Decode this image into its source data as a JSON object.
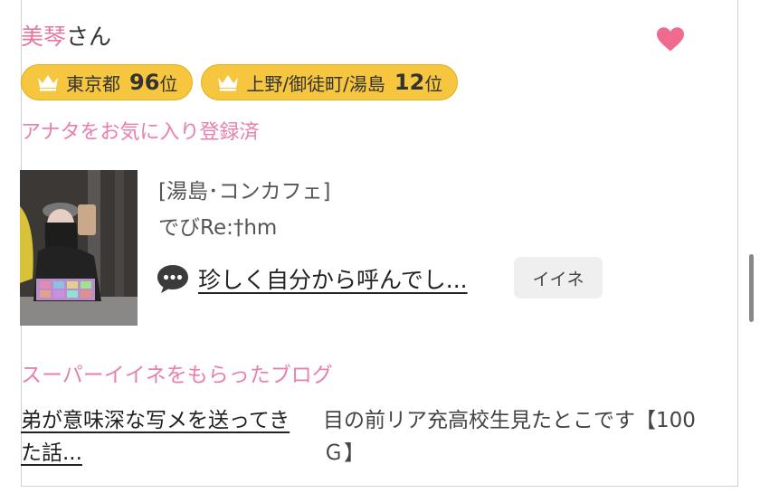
{
  "user": {
    "name": "美琴",
    "suffix": "さん"
  },
  "favorite_icon": "heart-icon",
  "badges": [
    {
      "icon": "crown-icon",
      "area": "東京都",
      "rank": "96",
      "unit": "位"
    },
    {
      "icon": "crown-icon",
      "area": "上野/御徒町/湯島",
      "rank": "12",
      "unit": "位"
    }
  ],
  "favorite_status": "アナタをお気に入り登録済",
  "shop": {
    "category": "[湯島･コンカフェ]",
    "name": "でびRe:†hm"
  },
  "comment": {
    "icon": "speech-bubble-icon",
    "text": "珍しく自分から呼んでし..."
  },
  "iine_label": "イイネ",
  "blog": {
    "heading": "スーパーイイネをもらったブログ",
    "title": "弟が意味深な写メを送ってきた話...",
    "related": "目の前リア充高校生見たとこです【100Ｇ】"
  },
  "colors": {
    "accent_pink": "#e8759c",
    "badge_gold": "#f6c63f",
    "heart": "#f06a8e"
  }
}
